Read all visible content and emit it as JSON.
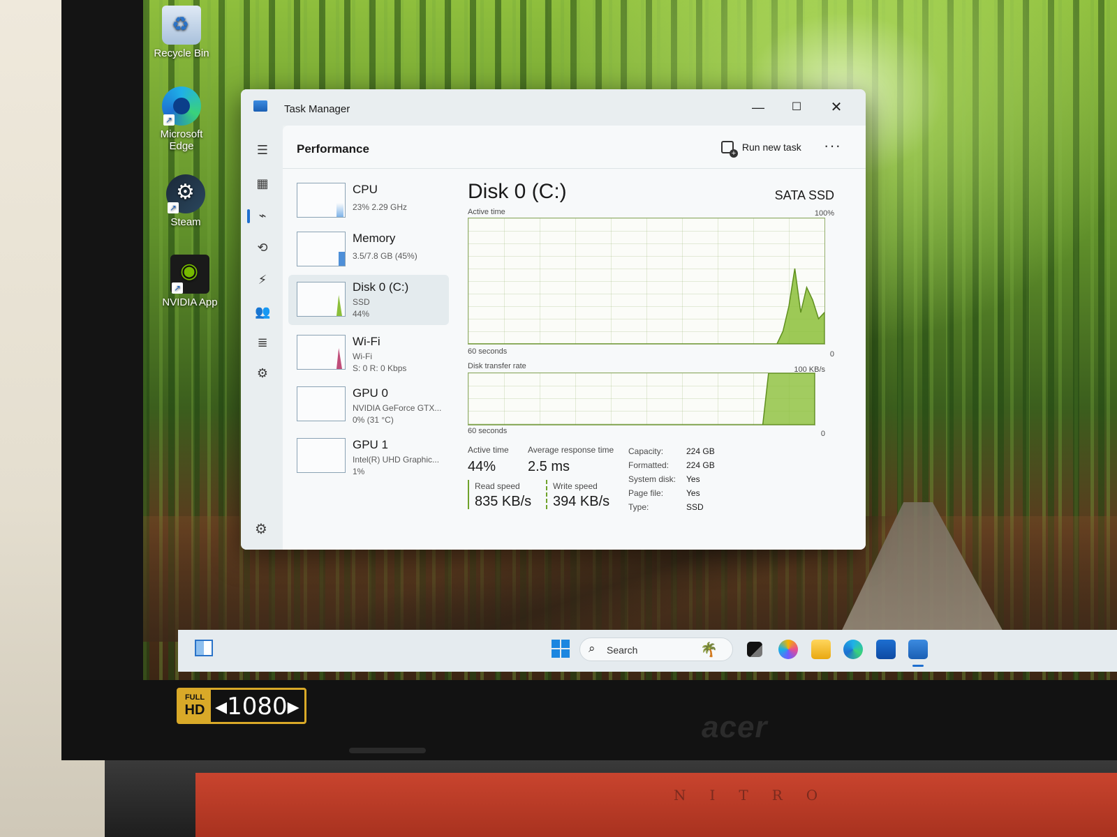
{
  "desktop": {
    "icons": [
      {
        "label": "Recycle Bin",
        "icon": "recycle-bin-icon"
      },
      {
        "label": "Microsoft Edge",
        "icon": "edge-icon"
      },
      {
        "label": "Steam",
        "icon": "steam-icon"
      },
      {
        "label": "NVIDIA App",
        "icon": "nvidia-icon"
      }
    ]
  },
  "window": {
    "title": "Task Manager",
    "min": "—",
    "max": "☐",
    "close": "✕"
  },
  "header": {
    "page_title": "Performance",
    "run_new_task": "Run new task",
    "more": "···"
  },
  "side_items": [
    {
      "name": "CPU",
      "sub1": "23% 2.29 GHz"
    },
    {
      "name": "Memory",
      "sub1": "3.5/7.8 GB (45%)"
    },
    {
      "name": "Disk 0 (C:)",
      "sub1": "SSD",
      "sub2": "44%"
    },
    {
      "name": "Wi-Fi",
      "sub1": "Wi-Fi",
      "sub2": "S: 0 R: 0 Kbps"
    },
    {
      "name": "GPU 0",
      "sub1": "NVIDIA GeForce GTX...",
      "sub2": "0% (31 °C)"
    },
    {
      "name": "GPU 1",
      "sub1": "Intel(R) UHD Graphic...",
      "sub2": "1%"
    }
  ],
  "disk": {
    "title": "Disk 0 (C:)",
    "model": "SATA SSD",
    "active_chart": {
      "label": "Active time",
      "max_label": "100%",
      "time_label": "60 seconds",
      "min_label": "0"
    },
    "transfer_chart": {
      "label": "Disk transfer rate",
      "max_label": "100 KB/s",
      "time_label": "60 seconds",
      "min_label": "0"
    },
    "stats": {
      "active_time_label": "Active time",
      "active_time_value": "44%",
      "avg_response_label": "Average response time",
      "avg_response_value": "2.5 ms",
      "read_label": "Read speed",
      "read_value": "835 KB/s",
      "write_label": "Write speed",
      "write_value": "394 KB/s"
    },
    "props": [
      {
        "label": "Capacity:",
        "value": "224 GB"
      },
      {
        "label": "Formatted:",
        "value": "224 GB"
      },
      {
        "label": "System disk:",
        "value": "Yes"
      },
      {
        "label": "Page file:",
        "value": "Yes"
      },
      {
        "label": "Type:",
        "value": "SSD"
      }
    ]
  },
  "chart_data": [
    {
      "type": "area",
      "title": "Active time",
      "x": [
        0,
        52,
        53,
        54,
        55,
        56,
        57,
        58,
        59,
        60
      ],
      "values": [
        0,
        0,
        10,
        30,
        60,
        25,
        45,
        35,
        20,
        25
      ],
      "xlabel": "60 seconds",
      "ylabel": "",
      "ylim": [
        0,
        100
      ],
      "grid": true
    },
    {
      "type": "area",
      "title": "Disk transfer rate",
      "x": [
        0,
        51,
        52,
        60
      ],
      "values": [
        0,
        0,
        100,
        100
      ],
      "xlabel": "60 seconds",
      "ylabel": "",
      "ylim": [
        0,
        100
      ],
      "grid": true
    }
  ],
  "taskbar": {
    "search_placeholder": "Search",
    "search_icon": "magnifier-icon"
  },
  "laptop": {
    "badge_top": "FULL",
    "badge_bottom": "HD",
    "badge_res": "◂1080▸",
    "brand": "acer",
    "model": "NITRO"
  },
  "colors": {
    "disk_green": "#8cbf3a",
    "accent_blue": "#1f6fcf"
  }
}
